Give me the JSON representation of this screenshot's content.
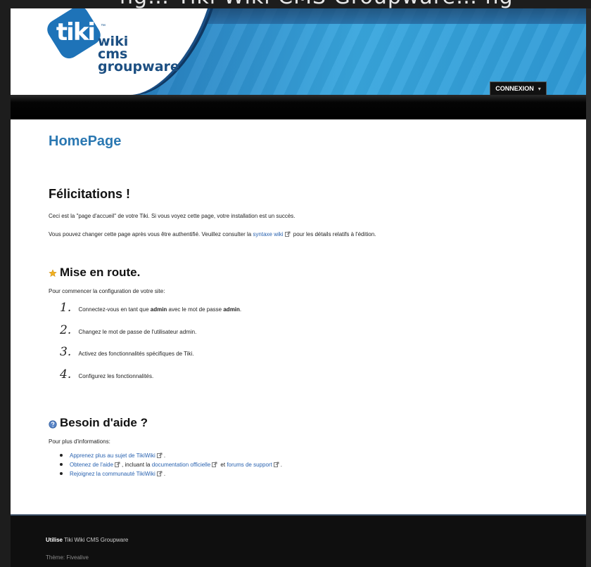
{
  "window": {
    "cut_title": "ng… Tiki Wiki CMS Groupware… ng"
  },
  "header": {
    "logo_bubble": "tiki",
    "logo_tm": "™",
    "logo_line1": "wiki",
    "logo_line2": "cms",
    "logo_line3": "groupware",
    "login_label": "CONNEXION",
    "login_caret": "▾"
  },
  "content": {
    "page_title": "HomePage",
    "congrats": {
      "heading": "Félicitations !",
      "p1": "Ceci est la \"page d'accueil\" de votre Tiki. Si vous voyez cette page, votre installation est un succès.",
      "p2_before": "Vous pouvez changer cette page après vous être authentifié. Veuillez consulter la ",
      "p2_link": "syntaxe wiki",
      "p2_after": " pour les détails relatifs à l'édition."
    },
    "getting_started": {
      "heading": "Mise en route.",
      "intro": "Pour commencer la configuration de votre site:",
      "steps": [
        {
          "num": "1.",
          "before": "Connectez-vous en tant que ",
          "bold1": "admin",
          "middle": " avec le mot de passe ",
          "bold2": "admin",
          "after": "."
        },
        {
          "num": "2.",
          "text": "Changez le mot de passe de l'utilisateur admin."
        },
        {
          "num": "3.",
          "text": "Activez des fonctionnalités spécifiques de Tiki."
        },
        {
          "num": "4.",
          "text": "Configurez les fonctionnalités."
        }
      ]
    },
    "help": {
      "heading": "Besoin d'aide ?",
      "intro": "Pour plus d'informations:",
      "items": [
        {
          "link": "Apprenez plus au sujet de TikiWiki",
          "after": "."
        },
        {
          "link": "Obtenez de l'aide",
          "middle": ", incluant la ",
          "link2": "documentation officielle",
          "middle2": " et ",
          "link3": "forums de support",
          "after": "."
        },
        {
          "link": "Rejoignez la communauté TikiWiki",
          "after": "."
        }
      ]
    }
  },
  "footer": {
    "powered_bold": "Utilise",
    "powered_rest": " Tiki Wiki CMS Groupware",
    "theme": "Thème: Fivealive"
  },
  "colors": {
    "link": "#2a63b0",
    "title": "#2b78b2",
    "star": "#f0b020",
    "help_icon": "#5a86c8"
  }
}
